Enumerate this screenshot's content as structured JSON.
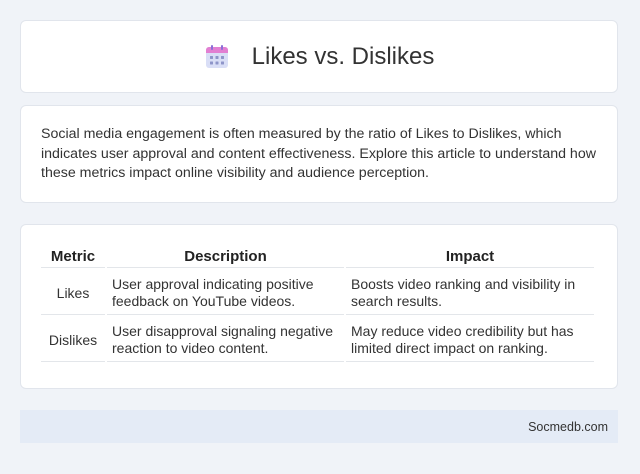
{
  "header": {
    "title": "Likes vs. Dislikes",
    "icon": "calendar-icon"
  },
  "intro": {
    "text": "Social media engagement is often measured by the ratio of Likes to Dislikes, which indicates user approval and content effectiveness. Explore this article to understand how these metrics impact online visibility and audience perception."
  },
  "table": {
    "columns": [
      "Metric",
      "Description",
      "Impact"
    ],
    "rows": [
      {
        "metric": "Likes",
        "description": "User approval indicating positive feedback on YouTube videos.",
        "impact": "Boosts video ranking and visibility in search results."
      },
      {
        "metric": "Dislikes",
        "description": "User disapproval signaling negative reaction to video content.",
        "impact": "May reduce video credibility but has limited direct impact on ranking."
      }
    ]
  },
  "footer": {
    "text": "Socmedb.com"
  },
  "colors": {
    "background": "#f0f3f8",
    "footer_bg": "#e4ebf6",
    "icon_top": "#e57fd0",
    "icon_body": "#d7ddf7"
  }
}
